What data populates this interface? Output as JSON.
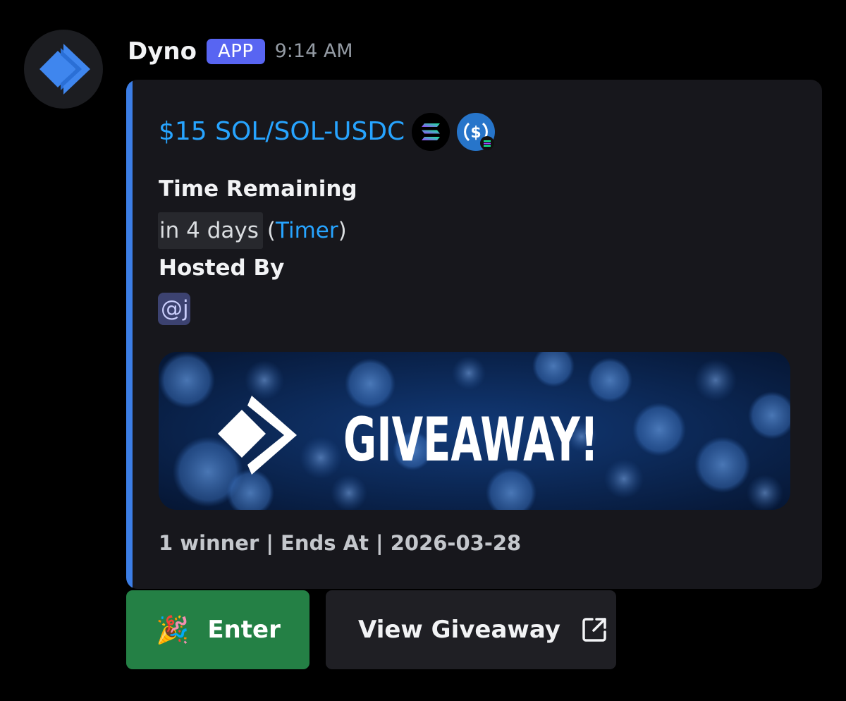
{
  "message": {
    "author": "Dyno",
    "badge": "APP",
    "timestamp": "9:14 AM",
    "avatar_icon": "dyno-logo-icon"
  },
  "embed": {
    "accent_color": "#3c7ee6",
    "title": "$15 SOL/SOL-USDC",
    "title_icons": [
      "solana-coin-icon",
      "usdc-coin-icon"
    ],
    "fields": [
      {
        "name": "Time Remaining",
        "value_relative": "in 4 days",
        "value_open": "(",
        "value_link": "Timer",
        "value_close": ")"
      },
      {
        "name": "Hosted By",
        "value_mention": "@j"
      }
    ],
    "image": {
      "text": "GIVEAWAY!",
      "icon": "dyno-logo-icon"
    },
    "footer": "1 winner | Ends At | 2026-03-28"
  },
  "buttons": [
    {
      "label": "Enter",
      "emoji": "🎉",
      "style": "success",
      "color": "#248045"
    },
    {
      "label": "View Giveaway",
      "icon": "external-link-icon",
      "style": "link"
    }
  ]
}
